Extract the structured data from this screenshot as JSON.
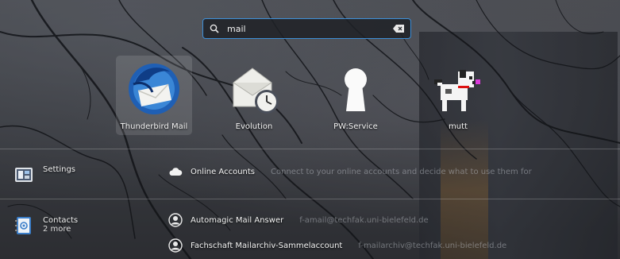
{
  "search": {
    "value": "mail",
    "placeholder": ""
  },
  "apps": [
    {
      "name": "Thunderbird Mail",
      "icon": "thunderbird-icon",
      "selected": true
    },
    {
      "name": "Evolution",
      "icon": "evolution-icon",
      "selected": false
    },
    {
      "name": "PW:Service",
      "icon": "keyhole-icon",
      "selected": false
    },
    {
      "name": "mutt",
      "icon": "mutt-dog-icon",
      "selected": false
    }
  ],
  "providers": [
    {
      "name": "Settings",
      "more": "",
      "icon": "settings-icon",
      "results": [
        {
          "title": "Online Accounts",
          "description": "Connect to your online accounts and decide what to use them for",
          "icon": "cloud-icon"
        }
      ]
    },
    {
      "name": "Contacts",
      "more": "2 more",
      "icon": "contacts-icon",
      "results": [
        {
          "title": "Automagic Mail Answer",
          "description": "f-amail@techfak.uni-bielefeld.de",
          "icon": "contact-avatar-icon"
        },
        {
          "title": "Fachschaft Mailarchiv-Sammelaccount",
          "description": "f-mailarchiv@techfak.uni-bielefeld.de",
          "icon": "contact-avatar-icon"
        }
      ]
    }
  ],
  "colors": {
    "accent": "#3d8fd8",
    "text": "#f4f4f4",
    "dim_text": "#9aa0a6"
  }
}
